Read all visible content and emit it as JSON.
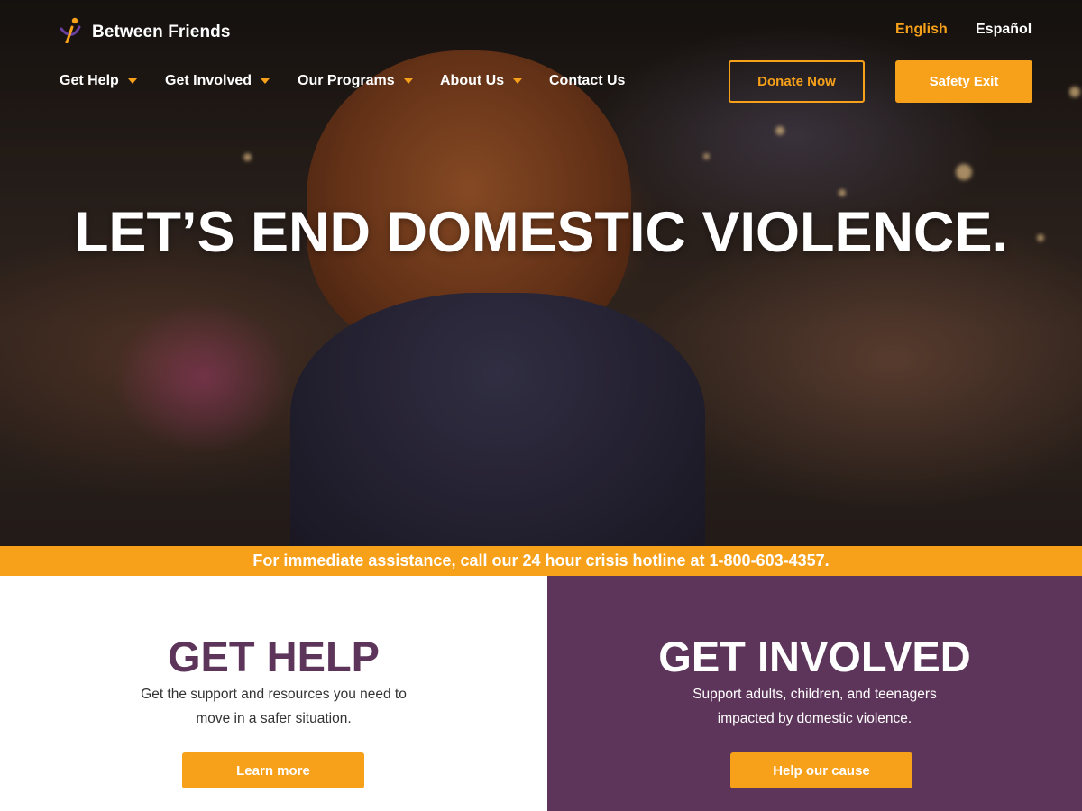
{
  "brand": {
    "name": "Between Friends"
  },
  "language": {
    "english": "English",
    "spanish": "Español"
  },
  "nav": [
    {
      "label": "Get Help",
      "has_dropdown": true
    },
    {
      "label": "Get Involved",
      "has_dropdown": true
    },
    {
      "label": "Our Programs",
      "has_dropdown": true
    },
    {
      "label": "About Us",
      "has_dropdown": true
    },
    {
      "label": "Contact Us",
      "has_dropdown": false
    }
  ],
  "header_buttons": {
    "donate": "Donate Now",
    "safety_exit": "Safety Exit"
  },
  "hero": {
    "title": "LET’S END DOMESTIC VIOLENCE."
  },
  "banner": {
    "text": "For immediate assistance, call our 24 hour crisis hotline at 1-800-603-4357."
  },
  "panels": {
    "get_help": {
      "title": "GET HELP",
      "line1": "Get the support and resources you need to",
      "line2": "move in a safer situation.",
      "button": "Learn more"
    },
    "get_involved": {
      "title": "GET INVOLVED",
      "line1": "Support adults, children, and teenagers",
      "line2": "impacted by domestic violence.",
      "button": "Help our cause"
    }
  },
  "colors": {
    "accent": "#f7a11a",
    "purple": "#5e355a",
    "white": "#ffffff"
  },
  "icons": {
    "logo": "figure-logo-icon",
    "dropdown": "caret-down-icon"
  }
}
